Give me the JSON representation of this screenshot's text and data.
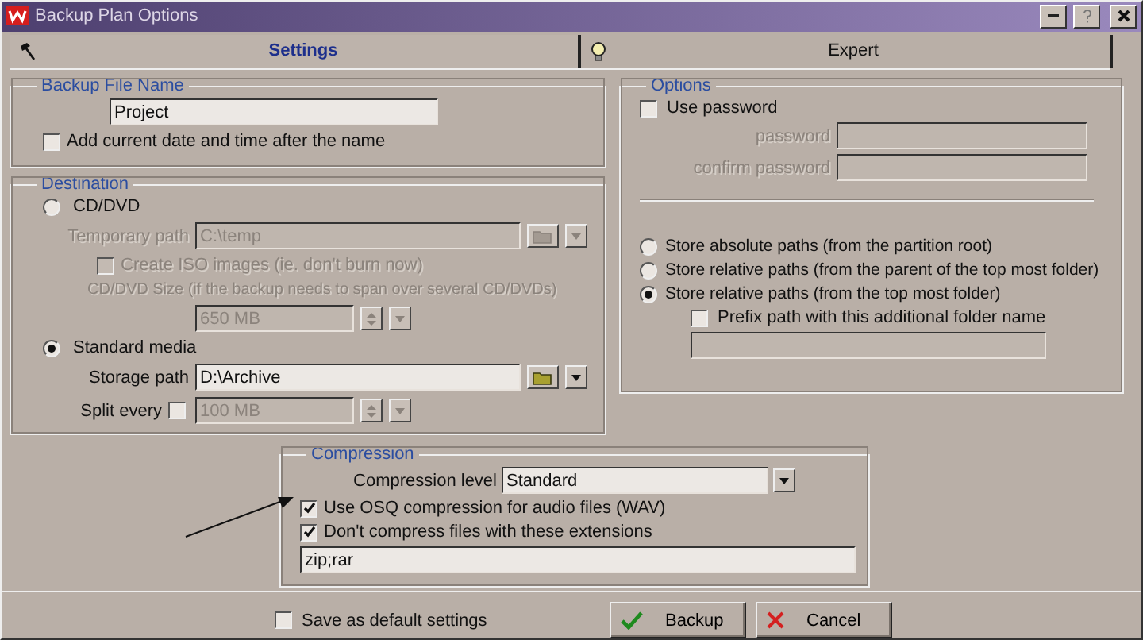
{
  "window": {
    "title": "Backup Plan Options"
  },
  "tabs": [
    {
      "label": "Settings",
      "selected": true
    },
    {
      "label": "Expert",
      "selected": false
    }
  ],
  "backup_file_name": {
    "title": "Backup File Name",
    "name_value": "Project",
    "add_date": {
      "label": "Add current date and time after the name",
      "checked": false
    }
  },
  "destination": {
    "title": "Destination",
    "cd_dvd": {
      "label": "CD/DVD",
      "selected": false,
      "temporary_path_label": "Temporary path",
      "temporary_path": "C:\\temp",
      "create_iso": {
        "label": "Create ISO images (ie. don't burn now)",
        "checked": false
      },
      "size_note": "CD/DVD Size (if the backup needs to span over several CD/DVDs)",
      "size": "650 MB"
    },
    "standard_media": {
      "label": "Standard media",
      "selected": true,
      "storage_path_label": "Storage path",
      "storage_path": "D:\\Archive",
      "split_every": {
        "label": "Split every",
        "checked": false,
        "value": "100 MB"
      }
    }
  },
  "options": {
    "title": "Options",
    "use_password": {
      "label": "Use password",
      "checked": false
    },
    "password_label": "password",
    "confirm_label": "confirm password",
    "path_modes": [
      {
        "label": "Store absolute paths (from the partition root)",
        "selected": false
      },
      {
        "label": "Store relative paths (from the parent of the top most folder)",
        "selected": false
      },
      {
        "label": "Store relative paths (from the top most folder)",
        "selected": true
      }
    ],
    "prefix": {
      "label": "Prefix path with this additional folder name",
      "checked": false
    }
  },
  "compression": {
    "title": "Compression",
    "level_label": "Compression level",
    "level_value": "Standard",
    "osq": {
      "label": "Use OSQ compression for audio files (WAV)",
      "checked": true
    },
    "exclude": {
      "label": "Don't compress files with these extensions",
      "checked": true
    },
    "extensions": "zip;rar"
  },
  "save_default": {
    "label": "Save as default settings",
    "checked": false
  },
  "buttons": [
    {
      "label": "Backup",
      "kind": "ok"
    },
    {
      "label": "Cancel",
      "kind": "cancel"
    }
  ]
}
